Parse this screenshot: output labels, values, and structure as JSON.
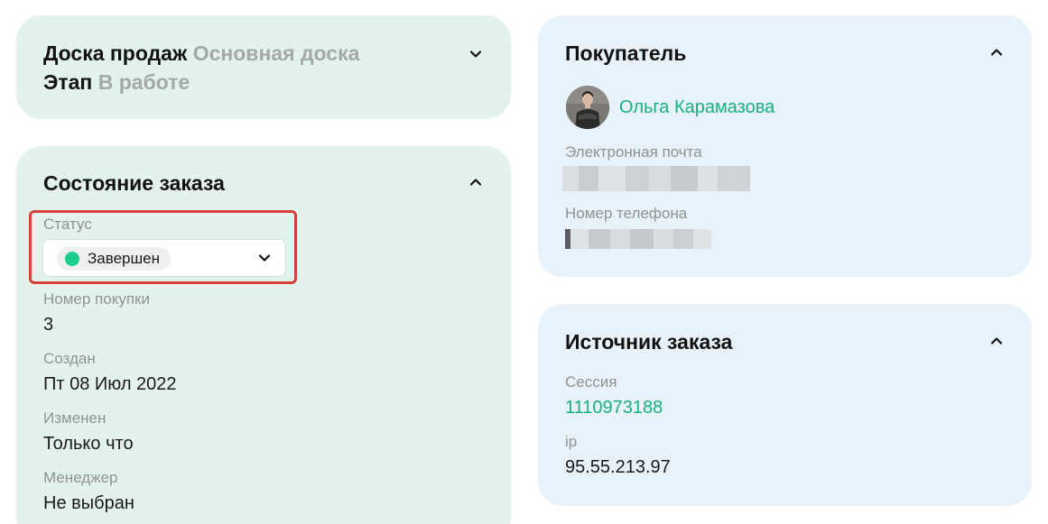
{
  "board": {
    "board_label": "Доска продаж",
    "board_value": "Основная доска",
    "stage_label": "Этап",
    "stage_value": "В работе"
  },
  "order_state": {
    "title": "Состояние заказа",
    "status_label": "Статус",
    "status_value": "Завершен",
    "status_color": "#1ccf8c",
    "purchase_label": "Номер покупки",
    "purchase_value": "3",
    "created_label": "Создан",
    "created_value": "Пт 08 Июл 2022",
    "changed_label": "Изменен",
    "changed_value": "Только что",
    "manager_label": "Менеджер",
    "manager_value": "Не выбран"
  },
  "buyer": {
    "title": "Покупатель",
    "name": "Ольга Карамазова",
    "email_label": "Электронная почта",
    "phone_label": "Номер телефона"
  },
  "source": {
    "title": "Источник заказа",
    "session_label": "Сессия",
    "session_value": "1110973188",
    "ip_label": "ip",
    "ip_value": "95.55.213.97"
  },
  "colors": {
    "accent": "#18b07d",
    "highlight_border": "#d6403a",
    "card_green": "#e3f3ec",
    "card_blue": "#e8f2fa"
  }
}
